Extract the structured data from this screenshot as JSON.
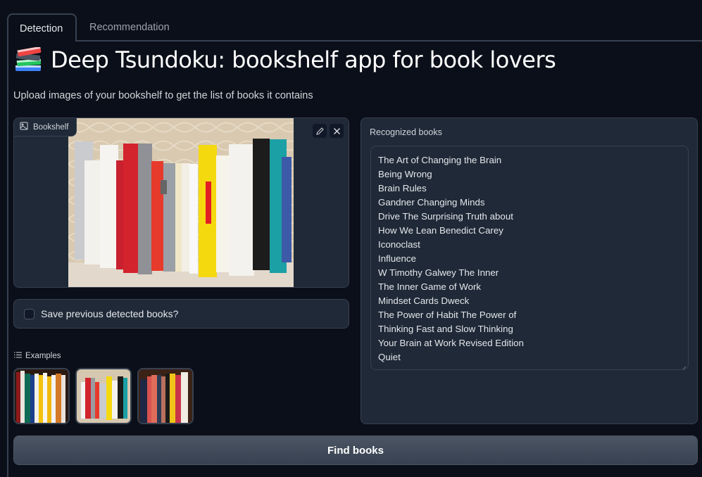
{
  "tabs": [
    {
      "label": "Detection",
      "active": true
    },
    {
      "label": "Recommendation",
      "active": false
    }
  ],
  "header": {
    "icon": "books-emoji-icon",
    "title": "Deep Tsundoku: bookshelf app for book lovers",
    "subtitle": "Upload images of your bookshelf to get the list of books it contains"
  },
  "image_input": {
    "label": "Bookshelf",
    "label_icon": "image-icon",
    "edit_icon": "pencil-icon",
    "clear_icon": "close-icon"
  },
  "checkbox": {
    "label": "Save previous detected books?",
    "checked": false
  },
  "examples": {
    "label": "Examples",
    "icon": "list-icon",
    "count": 3
  },
  "result": {
    "label": "Recognized books",
    "books": [
      "The Art of Changing the Brain",
      "Being Wrong",
      "Brain Rules",
      "Gandner Changing Minds",
      "Drive The Surprising Truth about",
      "How We Lean Benedict Carey",
      "Iconoclast",
      "Influence",
      "W Timothy Galwey The Inner",
      "The Inner Game of Work",
      "Mindset Cards Dweck",
      "The Power of Habit The Power of",
      "Thinking Fast and Slow Thinking",
      "Your Brain at Work Revised Edition",
      "Quiet"
    ]
  },
  "action": {
    "find_label": "Find books"
  },
  "colors": {
    "background": "#0b0f19",
    "panel": "#1f2937",
    "border": "#374151",
    "button": "#4b5563"
  }
}
